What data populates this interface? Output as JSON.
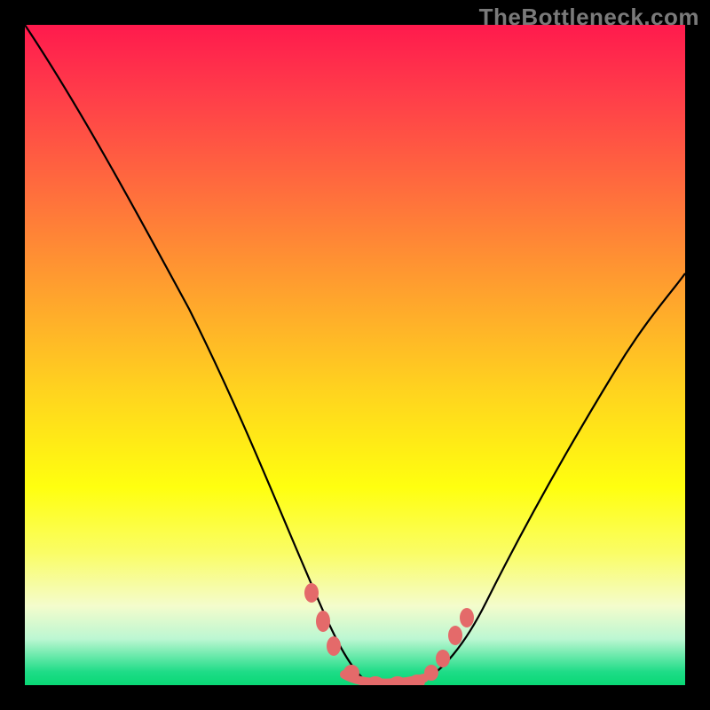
{
  "watermark": "TheBottleneck.com",
  "chart_data": {
    "type": "line",
    "title": "",
    "xlabel": "",
    "ylabel": "",
    "xlim": [
      0,
      100
    ],
    "ylim": [
      0,
      100
    ],
    "note": "Axes are unlabeled; values are estimated from pixel positions as percentage of plot area. y=0 is green (good), y=100 is red (bad). Curve resembles a bottleneck V-shape.",
    "series": [
      {
        "name": "bottleneck-curve",
        "color": "#000000",
        "x": [
          0,
          5,
          10,
          15,
          20,
          25,
          30,
          35,
          40,
          43,
          46,
          49,
          50,
          52,
          55,
          58,
          60,
          63,
          66,
          70,
          75,
          80,
          85,
          90,
          95,
          100
        ],
        "y": [
          100,
          91,
          82,
          73,
          64,
          55,
          46,
          36,
          25,
          17,
          10,
          4,
          1,
          0,
          0,
          0,
          1,
          4,
          9,
          16,
          25,
          33,
          41,
          48,
          55,
          62
        ]
      }
    ],
    "markers": {
      "name": "highlight-dots",
      "color": "#e46a6a",
      "x": [
        43.5,
        45.5,
        47.0,
        50.0,
        53.0,
        56.0,
        59.0,
        61.0,
        63.0,
        65.0,
        66.8
      ],
      "y": [
        14.0,
        10.0,
        6.0,
        1.5,
        0.3,
        0.3,
        0.5,
        1.6,
        3.8,
        7.4,
        10.0
      ]
    },
    "markers_line": {
      "name": "highlight-segment",
      "color": "#e46a6a",
      "x": [
        49,
        50,
        52,
        55,
        58,
        60
      ],
      "y": [
        2,
        1,
        0,
        0,
        0,
        1
      ]
    }
  }
}
